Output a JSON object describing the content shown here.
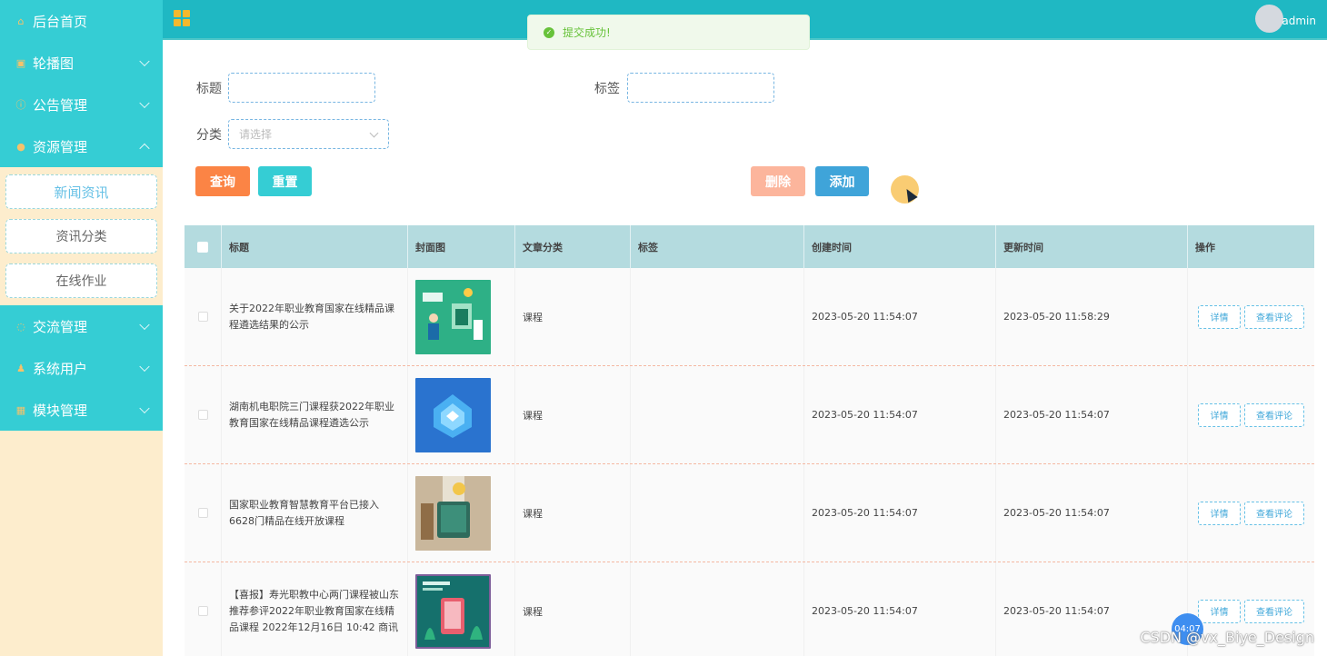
{
  "sidebar": {
    "items": [
      {
        "label": "后台首页",
        "icon": "home-icon",
        "glyph": "⌂"
      },
      {
        "label": "轮播图",
        "icon": "image-icon",
        "glyph": "▣"
      },
      {
        "label": "公告管理",
        "icon": "info-icon",
        "glyph": "ⓘ"
      },
      {
        "label": "资源管理",
        "icon": "bulb-icon",
        "glyph": "●"
      }
    ],
    "sub_items": [
      {
        "label": "新闻资讯"
      },
      {
        "label": "资讯分类"
      },
      {
        "label": "在线作业"
      }
    ],
    "items_bottom": [
      {
        "label": "交流管理",
        "icon": "chat-icon",
        "glyph": "◌"
      },
      {
        "label": "系统用户",
        "icon": "user-icon",
        "glyph": "♟"
      },
      {
        "label": "模块管理",
        "icon": "modules-icon",
        "glyph": "▦"
      }
    ]
  },
  "header": {
    "user_name": "admin",
    "grid_icon": "grid-icon"
  },
  "toast": {
    "message": "提交成功!",
    "icon": "check-circle-icon"
  },
  "form": {
    "title_label": "标题",
    "title_value": "",
    "tag_label": "标签",
    "tag_value": "",
    "category_label": "分类",
    "category_placeholder": "请选择"
  },
  "buttons": {
    "query": "查询",
    "reset": "重置",
    "delete": "删除",
    "add": "添加"
  },
  "table": {
    "headers": {
      "title": "标题",
      "cover": "封面图",
      "category": "文章分类",
      "tags": "标签",
      "created": "创建时间",
      "updated": "更新时间",
      "actions": "操作"
    },
    "rows": [
      {
        "title": "关于2022年职业教育国家在线精品课程遴选结果的公示",
        "category": "课程",
        "tags": "",
        "created": "2023-05-20 11:54:07",
        "updated": "2023-05-20 11:58:29",
        "detail": "详情",
        "comments": "查看评论"
      },
      {
        "title": "湖南机电职院三门课程获2022年职业教育国家在线精品课程遴选公示",
        "category": "课程",
        "tags": "",
        "created": "2023-05-20 11:54:07",
        "updated": "2023-05-20 11:54:07",
        "detail": "详情",
        "comments": "查看评论"
      },
      {
        "title": "国家职业教育智慧教育平台已接入6628门精品在线开放课程",
        "category": "课程",
        "tags": "",
        "created": "2023-05-20 11:54:07",
        "updated": "2023-05-20 11:54:07",
        "detail": "详情",
        "comments": "查看评论"
      },
      {
        "title": "【喜报】寿光职教中心两门课程被山东推荐参评2022年职业教育国家在线精品课程 2022年12月16日 10:42 商讯",
        "category": "课程",
        "tags": "",
        "created": "2023-05-20 11:54:07",
        "updated": "2023-05-20 11:54:07",
        "detail": "详情",
        "comments": "查看评论"
      }
    ]
  },
  "overlay": {
    "time_badge": "04:07",
    "watermark": "CSDN @vx_Biye_Design"
  },
  "colors": {
    "sidebar_menu": "#35cdd4",
    "header": "#1fb8c3",
    "query_btn": "#fb8445",
    "reset_btn": "#35cdd4",
    "delete_btn": "#fcb59c",
    "add_btn": "#3fa4d9",
    "table_head": "#b4dbdf"
  }
}
